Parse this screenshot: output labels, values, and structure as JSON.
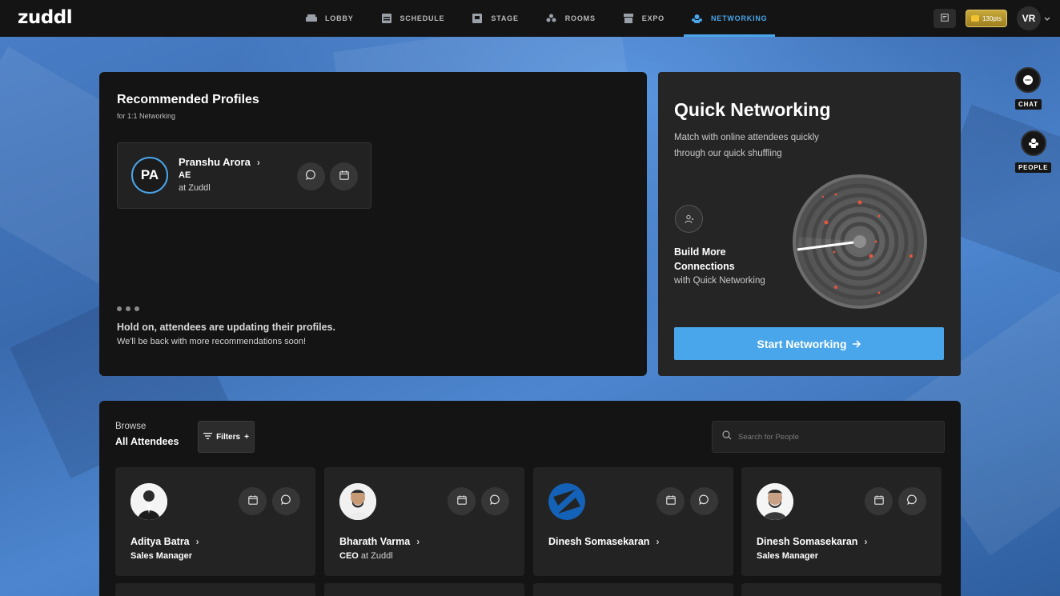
{
  "app": {
    "logo": "zuddl"
  },
  "nav": {
    "items": [
      {
        "label": "LOBBY",
        "icon": "sofa-icon",
        "active": false
      },
      {
        "label": "SCHEDULE",
        "icon": "schedule-icon",
        "active": false
      },
      {
        "label": "STAGE",
        "icon": "stage-icon",
        "active": false
      },
      {
        "label": "ROOMS",
        "icon": "rooms-icon",
        "active": false
      },
      {
        "label": "EXPO",
        "icon": "expo-icon",
        "active": false
      },
      {
        "label": "NETWORKING",
        "icon": "networking-icon",
        "active": true
      }
    ],
    "points": "130pts",
    "user_initials": "VR"
  },
  "recommended": {
    "title": "Recommended Profiles",
    "subtitle": "for 1:1 Networking",
    "profile": {
      "initials": "PA",
      "name": "Pranshu Arora",
      "role": "AE",
      "company": "at Zuddl"
    },
    "hold_title": "Hold on, attendees are updating their profiles.",
    "hold_sub": "We'll be back with more recommendations soon!"
  },
  "quick_networking": {
    "title": "Quick Networking",
    "description": "Match with online attendees quickly through our quick shuffling",
    "build_title": "Build More Connections",
    "build_sub": "with Quick Networking",
    "button": "Start Networking"
  },
  "side": {
    "chat": "CHAT",
    "people": "PEOPLE"
  },
  "browse": {
    "label": "Browse",
    "title": "All Attendees",
    "filters": "Filters",
    "search_placeholder": "Search for People",
    "attendees": [
      {
        "name": "Aditya Batra",
        "role": "Sales Manager",
        "company": ""
      },
      {
        "name": "Bharath Varma",
        "role": "CEO",
        "company": " at Zuddl"
      },
      {
        "name": "Dinesh Somasekaran",
        "role": "",
        "company": ""
      },
      {
        "name": "Dinesh Somasekaran",
        "role": "Sales Manager",
        "company": ""
      }
    ]
  },
  "colors": {
    "accent": "#4aa6ea",
    "panel": "#141414",
    "card": "#232323"
  }
}
